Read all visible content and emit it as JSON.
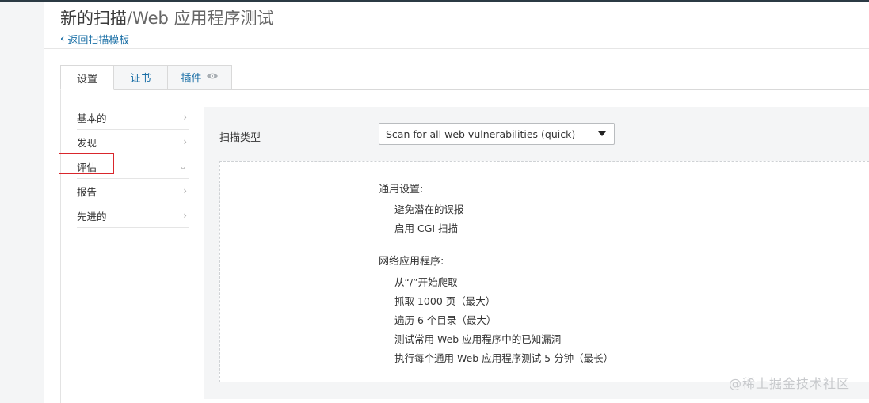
{
  "header": {
    "title_main": "新的扫描",
    "title_sub": "/Web 应用程序测试",
    "back_label": "返回扫描模板"
  },
  "tabs": [
    {
      "label": "设置",
      "active": true
    },
    {
      "label": "证书",
      "active": false
    },
    {
      "label": "插件",
      "active": false
    }
  ],
  "sidebar": {
    "items": [
      {
        "label": "基本的",
        "chevron": "›"
      },
      {
        "label": "发现",
        "chevron": "›"
      },
      {
        "label": "评估",
        "chevron": "⌄"
      },
      {
        "label": "报告",
        "chevron": "›"
      },
      {
        "label": "先进的",
        "chevron": "›"
      }
    ]
  },
  "form": {
    "scan_type_label": "扫描类型",
    "scan_type_value": "Scan for all web vulnerabilities (quick)"
  },
  "summary": {
    "general_title": "通用设置:",
    "general_items": [
      "避免潜在的误报",
      "启用 CGI 扫描"
    ],
    "webapp_title": "网络应用程序:",
    "webapp_items": [
      "从“/”开始爬取",
      "抓取 1000 页（最大）",
      "遍历 6 个目录（最大）",
      "测试常用 Web 应用程序中的已知漏洞",
      "执行每个通用 Web 应用程序测试 5 分钟（最长）"
    ]
  },
  "watermark": "@稀土掘金技术社区",
  "colors": {
    "accent": "#1a6fa6",
    "highlight": "#d9262c",
    "panel_bg": "#f4f5f6"
  }
}
